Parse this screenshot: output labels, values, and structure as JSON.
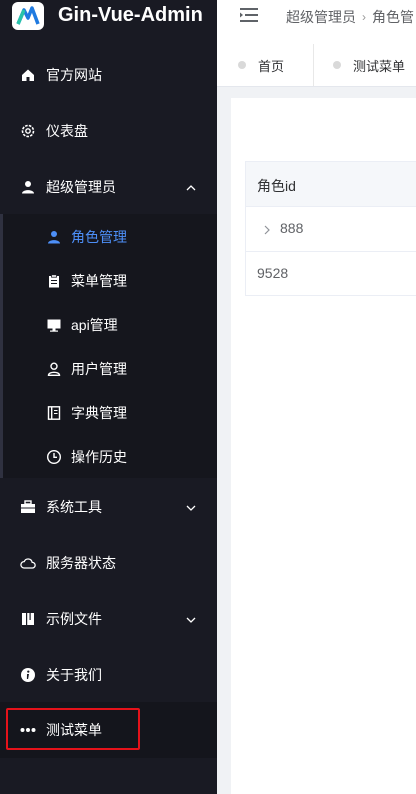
{
  "app": {
    "title": "Gin-Vue-Admin"
  },
  "sidebar": {
    "items": [
      {
        "label": "官方网站",
        "icon": "home-icon"
      },
      {
        "label": "仪表盘",
        "icon": "gear-icon"
      },
      {
        "label": "超级管理员",
        "icon": "user-icon",
        "expanded": true
      },
      {
        "label": "系统工具",
        "icon": "toolbox-icon"
      },
      {
        "label": "服务器状态",
        "icon": "cloud-icon"
      },
      {
        "label": "示例文件",
        "icon": "folder-icon"
      },
      {
        "label": "关于我们",
        "icon": "info-icon"
      },
      {
        "label": "测试菜单",
        "icon": "more-icon"
      }
    ],
    "sub_items": [
      {
        "label": "角色管理",
        "icon": "user-icon",
        "active": true
      },
      {
        "label": "菜单管理",
        "icon": "clipboard-icon"
      },
      {
        "label": "api管理",
        "icon": "monitor-icon"
      },
      {
        "label": "用户管理",
        "icon": "user-outline-icon"
      },
      {
        "label": "字典管理",
        "icon": "book-icon"
      },
      {
        "label": "操作历史",
        "icon": "clock-icon"
      }
    ]
  },
  "header": {
    "breadcrumbs": [
      "超级管理员",
      "角色管"
    ]
  },
  "tabs": [
    {
      "label": "首页"
    },
    {
      "label": "测试菜单"
    }
  ],
  "table": {
    "columns": [
      "角色id"
    ],
    "rows": [
      {
        "id": "888",
        "expandable": true
      },
      {
        "id": "9528",
        "expandable": false
      }
    ]
  },
  "colors": {
    "sidebar_bg": "#191a23",
    "active": "#4d8ff8",
    "highlight_border": "#e5121a"
  }
}
